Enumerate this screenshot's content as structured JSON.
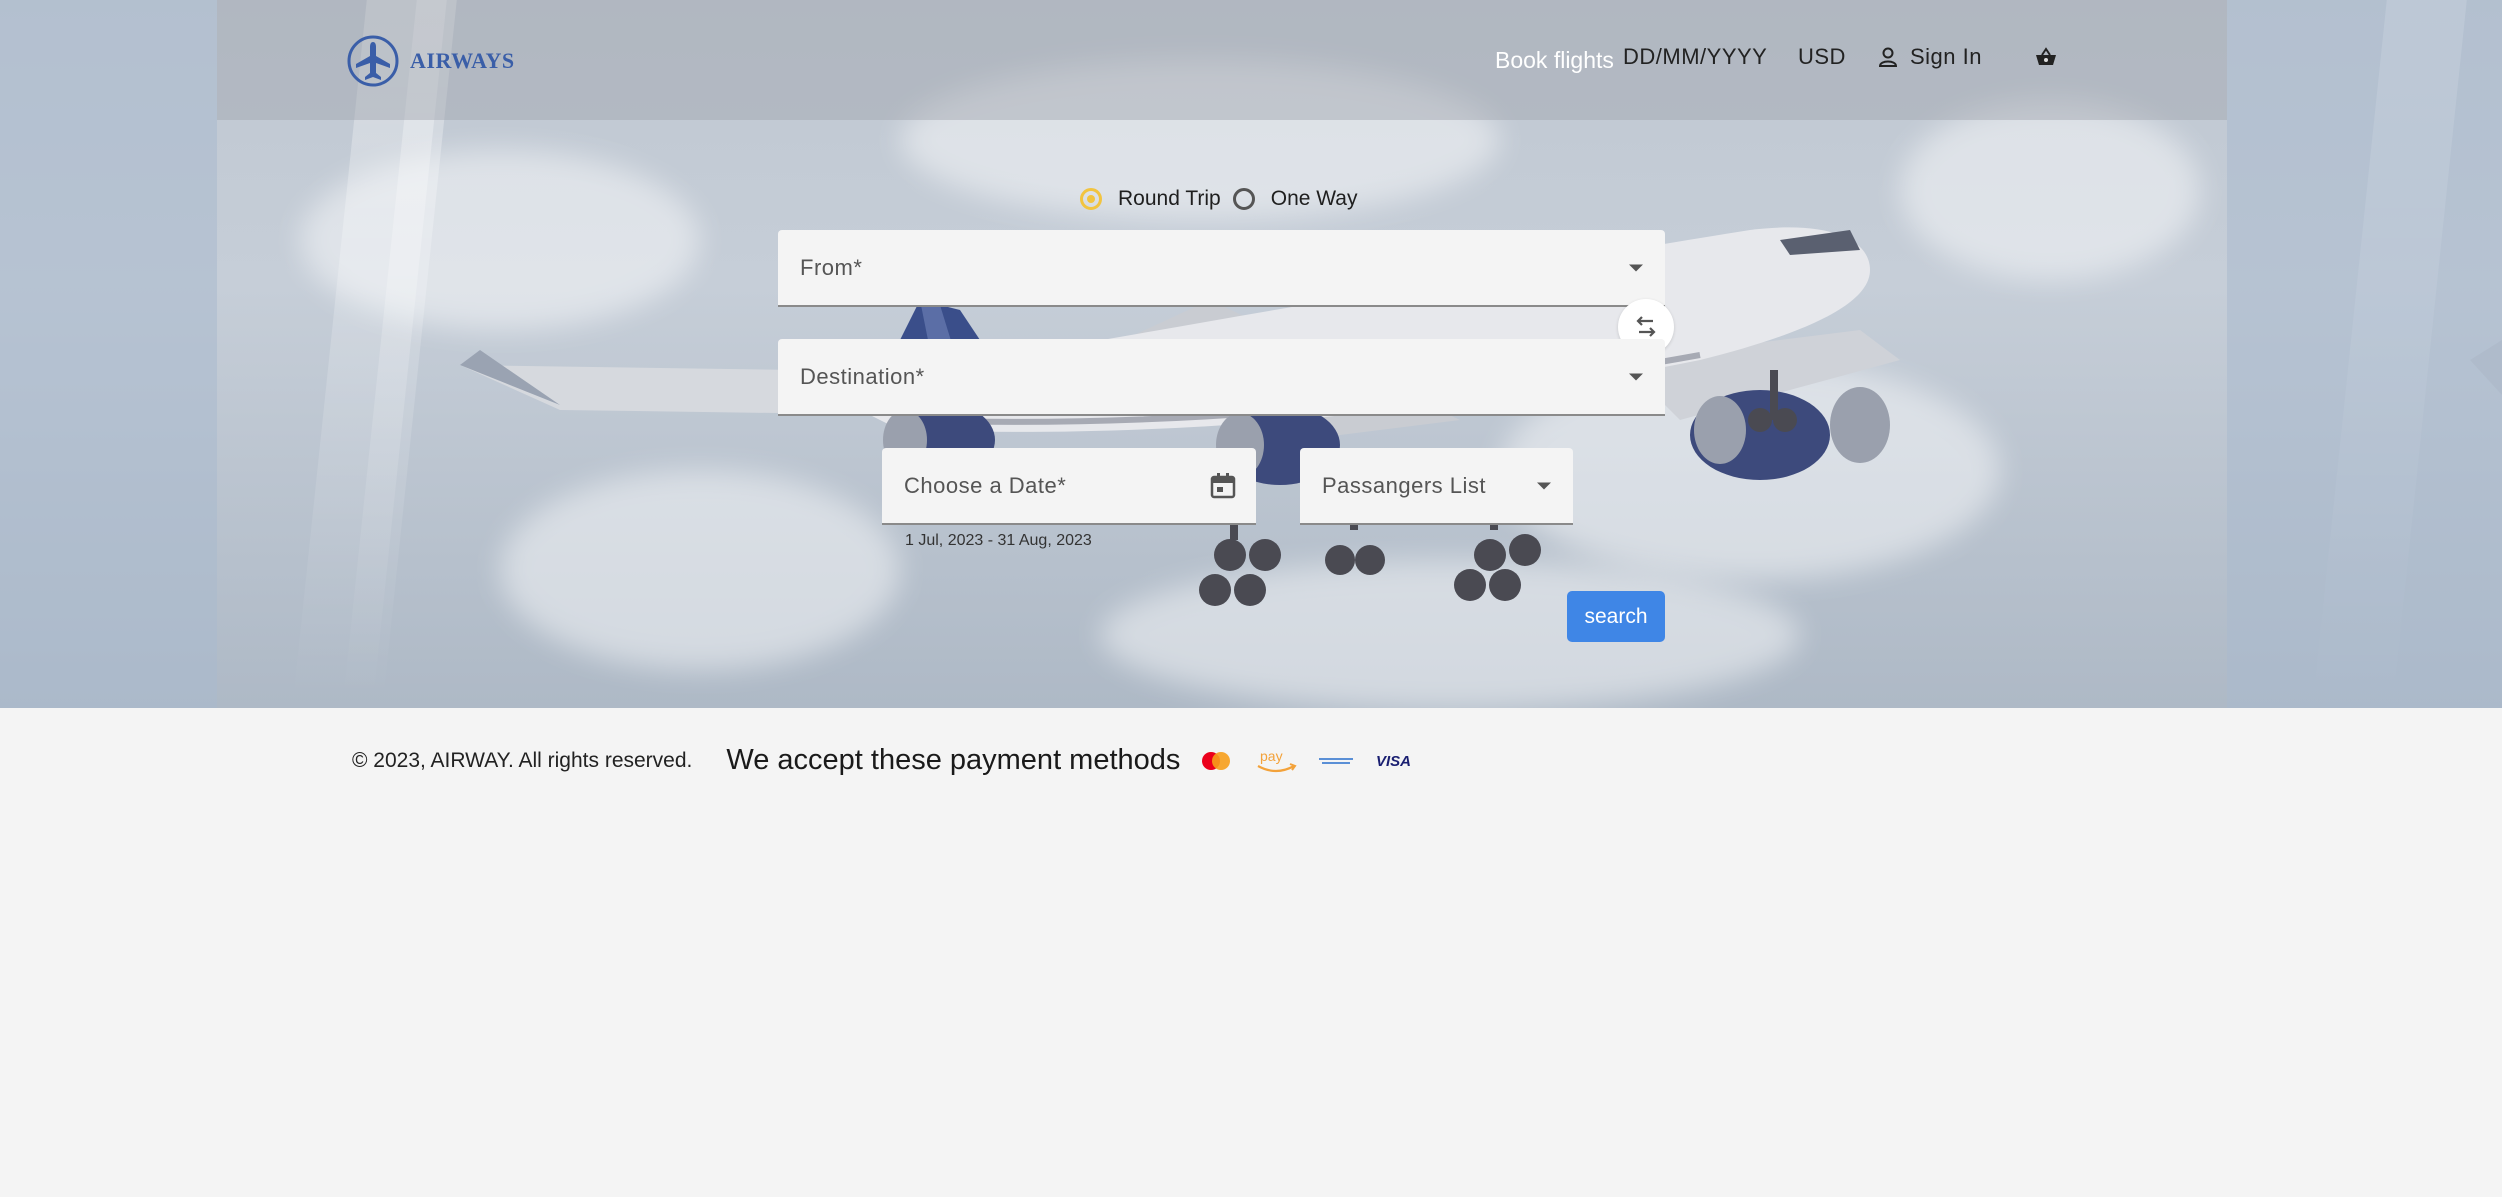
{
  "brand": {
    "name": "AIRWAYS"
  },
  "nav": {
    "book_flights": "Book flights",
    "date_format": "DD/MM/YYYY",
    "currency": "USD",
    "sign_in": "Sign In",
    "icons": {
      "user": "user-icon",
      "cart": "basket-icon"
    }
  },
  "trip_type": {
    "options": [
      "Round Trip",
      "One Way"
    ],
    "selected": "Round Trip",
    "accent_color": "#f2c440"
  },
  "form": {
    "from_label": "From*",
    "destination_label": "Destination*",
    "date_label": "Choose a Date*",
    "date_hint": "1 Jul, 2023 - 31 Aug, 2023",
    "passengers_label": "Passangers List",
    "search_label": "search",
    "search_color": "#3f86e6",
    "icons": {
      "swap": "swap-arrows-icon",
      "calendar": "calendar-icon",
      "dropdown": "caret-down-icon"
    }
  },
  "footer": {
    "copyright": "© 2023, AIRWAY. All rights reserved.",
    "payment_text": "We accept these payment methods",
    "payment_methods": [
      "mastercard-icon",
      "amazon-pay-icon",
      "american-express-icon",
      "visa-icon"
    ],
    "visa_text": "VISA",
    "amazon_text": "pay"
  }
}
